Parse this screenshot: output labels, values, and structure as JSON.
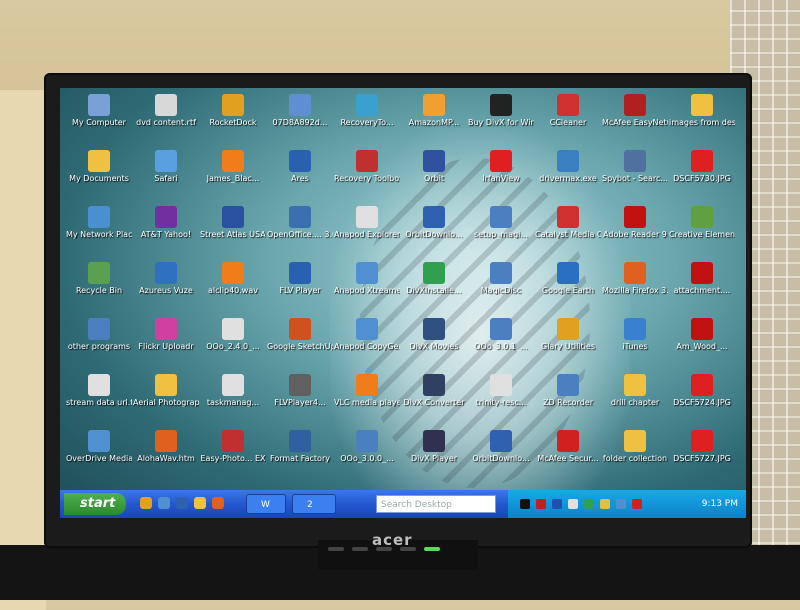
{
  "desktop": {
    "icons": [
      {
        "label": "My Computer",
        "icon": "computer-icon",
        "color": "#7aa0d8"
      },
      {
        "label": "dvd content.rtf",
        "icon": "document-icon",
        "color": "#d8d8d8"
      },
      {
        "label": "RocketDock",
        "icon": "rocket-icon",
        "color": "#e0a020"
      },
      {
        "label": "07D8A892d...",
        "icon": "image-file-icon",
        "color": "#5f8fd0"
      },
      {
        "label": "RecoveryTo...",
        "icon": "recovery-icon",
        "color": "#3aa0d0"
      },
      {
        "label": "AmazonMP...",
        "icon": "amazon-icon",
        "color": "#f0a030"
      },
      {
        "label": "Buy DivX for Windows",
        "icon": "divx-icon",
        "color": "#222222"
      },
      {
        "label": "CCleaner",
        "icon": "ccleaner-icon",
        "color": "#d03030"
      },
      {
        "label": "McAfee EasyNetwork",
        "icon": "mcafee-icon",
        "color": "#b02020"
      },
      {
        "label": "images from desktop",
        "icon": "folder-icon",
        "color": "#f0c040"
      },
      {
        "label": "My Documents",
        "icon": "folder-icon",
        "color": "#f0c040"
      },
      {
        "label": "Safari",
        "icon": "safari-icon",
        "color": "#5aa0e0"
      },
      {
        "label": "James_Blac...",
        "icon": "vlc-icon",
        "color": "#f07c1a"
      },
      {
        "label": "Ares",
        "icon": "ares-icon",
        "color": "#2a60b0"
      },
      {
        "label": "Recovery Toolbox for ...",
        "icon": "recovery-icon",
        "color": "#c03030"
      },
      {
        "label": "Orbit",
        "icon": "orbit-icon",
        "color": "#3050a0"
      },
      {
        "label": "IrfanView",
        "icon": "irfanview-icon",
        "color": "#e02020"
      },
      {
        "label": "drivermax.exe",
        "icon": "drivermax-icon",
        "color": "#3a80c0"
      },
      {
        "label": "Spybot - Searc...",
        "icon": "spybot-icon",
        "color": "#5070a0"
      },
      {
        "label": "DSCF5730.JPG",
        "icon": "image-file-icon",
        "color": "#e02020"
      },
      {
        "label": "My Network Places",
        "icon": "network-icon",
        "color": "#4a90d0"
      },
      {
        "label": "AT&T Yahoo!",
        "icon": "yahoo-icon",
        "color": "#7030a0"
      },
      {
        "label": "Street Atlas USA 2009",
        "icon": "atlas-icon",
        "color": "#2a50a0"
      },
      {
        "label": "OpenOffice.... 3.0",
        "icon": "openoffice-icon",
        "color": "#3a70b0"
      },
      {
        "label": "Anapod Explorer",
        "icon": "ipod-icon",
        "color": "#e0e0e0"
      },
      {
        "label": "OrbitDownlo...",
        "icon": "orbit-icon",
        "color": "#3060b0"
      },
      {
        "label": "setup_magi...",
        "icon": "setup-icon",
        "color": "#4a80c0"
      },
      {
        "label": "Catalyst Media Center",
        "icon": "catalyst-icon",
        "color": "#d03030"
      },
      {
        "label": "Adobe Reader 9",
        "icon": "pdf-icon",
        "color": "#c01010"
      },
      {
        "label": "Creative Element Po...",
        "icon": "creative-icon",
        "color": "#60a040"
      },
      {
        "label": "Recycle Bin",
        "icon": "recycle-bin-icon",
        "color": "#5aa050"
      },
      {
        "label": "Azureus Vuze",
        "icon": "vuze-icon",
        "color": "#3070c0"
      },
      {
        "label": "alclip40.wav",
        "icon": "vlc-icon",
        "color": "#f07c1a"
      },
      {
        "label": "FLV Player",
        "icon": "flv-player-icon",
        "color": "#2a60b0"
      },
      {
        "label": "Anapod Xtreamer",
        "icon": "ipod-icon",
        "color": "#5090d0"
      },
      {
        "label": "DivXInstalle...",
        "icon": "divx-icon",
        "color": "#30a050"
      },
      {
        "label": "MagicDisc",
        "icon": "disc-icon",
        "color": "#4a80c0"
      },
      {
        "label": "Google Earth",
        "icon": "earth-icon",
        "color": "#2a70c0"
      },
      {
        "label": "Mozilla Firefox 3.1 Beta 3",
        "icon": "firefox-icon",
        "color": "#e06020"
      },
      {
        "label": "attachment....",
        "icon": "pdf-icon",
        "color": "#c01010"
      },
      {
        "label": "other programs",
        "icon": "shortcut-icon",
        "color": "#4a80c0"
      },
      {
        "label": "Flickr Uploadr",
        "icon": "flickr-icon",
        "color": "#d040a0"
      },
      {
        "label": "OOo_2.4.0_...",
        "icon": "openoffice-icon",
        "color": "#e0e0e0"
      },
      {
        "label": "Google SketchUp 7",
        "icon": "sketchup-icon",
        "color": "#d05020"
      },
      {
        "label": "Anapod CopyGear",
        "icon": "ipod-icon",
        "color": "#5090d0"
      },
      {
        "label": "DivX Movies",
        "icon": "divx-icon",
        "color": "#305080"
      },
      {
        "label": "OOo_3.0.1_...",
        "icon": "setup-icon",
        "color": "#4a80c0"
      },
      {
        "label": "Glary Utilities",
        "icon": "glary-icon",
        "color": "#e0a020"
      },
      {
        "label": "iTunes",
        "icon": "itunes-icon",
        "color": "#3a80d0"
      },
      {
        "label": "Am_Wood_...",
        "icon": "pdf-icon",
        "color": "#c01010"
      },
      {
        "label": "stream data url.txt",
        "icon": "text-file-icon",
        "color": "#e0e0e0"
      },
      {
        "label": "Aerial Photography",
        "icon": "folder-icon",
        "color": "#f0c040"
      },
      {
        "label": "taskmanag...",
        "icon": "document-icon",
        "color": "#e0e0e0"
      },
      {
        "label": "FLVPlayer4...",
        "icon": "film-icon",
        "color": "#606060"
      },
      {
        "label": "VLC media player",
        "icon": "vlc-icon",
        "color": "#f07c1a"
      },
      {
        "label": "DivX Converter",
        "icon": "divx-icon",
        "color": "#304060"
      },
      {
        "label": "trinity-resc...",
        "icon": "document-icon",
        "color": "#e0e0e0"
      },
      {
        "label": "ZD Recorder",
        "icon": "recorder-icon",
        "color": "#4a80c0"
      },
      {
        "label": "drill chapter",
        "icon": "folder-icon",
        "color": "#f0c040"
      },
      {
        "label": "DSCF5724.JPG",
        "icon": "image-file-icon",
        "color": "#e02020"
      },
      {
        "label": "OverDrive Media Console",
        "icon": "overdrive-icon",
        "color": "#5090d0"
      },
      {
        "label": "AlohaWav.htm",
        "icon": "firefox-icon",
        "color": "#e06020"
      },
      {
        "label": "Easy-Photo... EX",
        "icon": "photo-icon",
        "color": "#c03030"
      },
      {
        "label": "Format Factory",
        "icon": "format-factory-icon",
        "color": "#3060a0"
      },
      {
        "label": "OOo_3.0.0_...",
        "icon": "setup-icon",
        "color": "#4a80c0"
      },
      {
        "label": "DivX Player",
        "icon": "divx-icon",
        "color": "#303050"
      },
      {
        "label": "OrbitDownlo...",
        "icon": "orbit-icon",
        "color": "#3060b0"
      },
      {
        "label": "McAfee Secur...",
        "icon": "mcafee-icon",
        "color": "#d02020"
      },
      {
        "label": "folder collection",
        "icon": "folder-icon",
        "color": "#f0c040"
      },
      {
        "label": "DSCF5727.JPG",
        "icon": "image-file-icon",
        "color": "#e02020"
      }
    ]
  },
  "taskbar": {
    "start_label": "start",
    "tasks": [
      {
        "label": "W",
        "icon": "window-icon"
      },
      {
        "label": "2",
        "icon": "firefox-icon"
      }
    ],
    "search_placeholder": "Search Desktop",
    "clock": "9:13 PM"
  },
  "monitor": {
    "brand": "acer"
  }
}
